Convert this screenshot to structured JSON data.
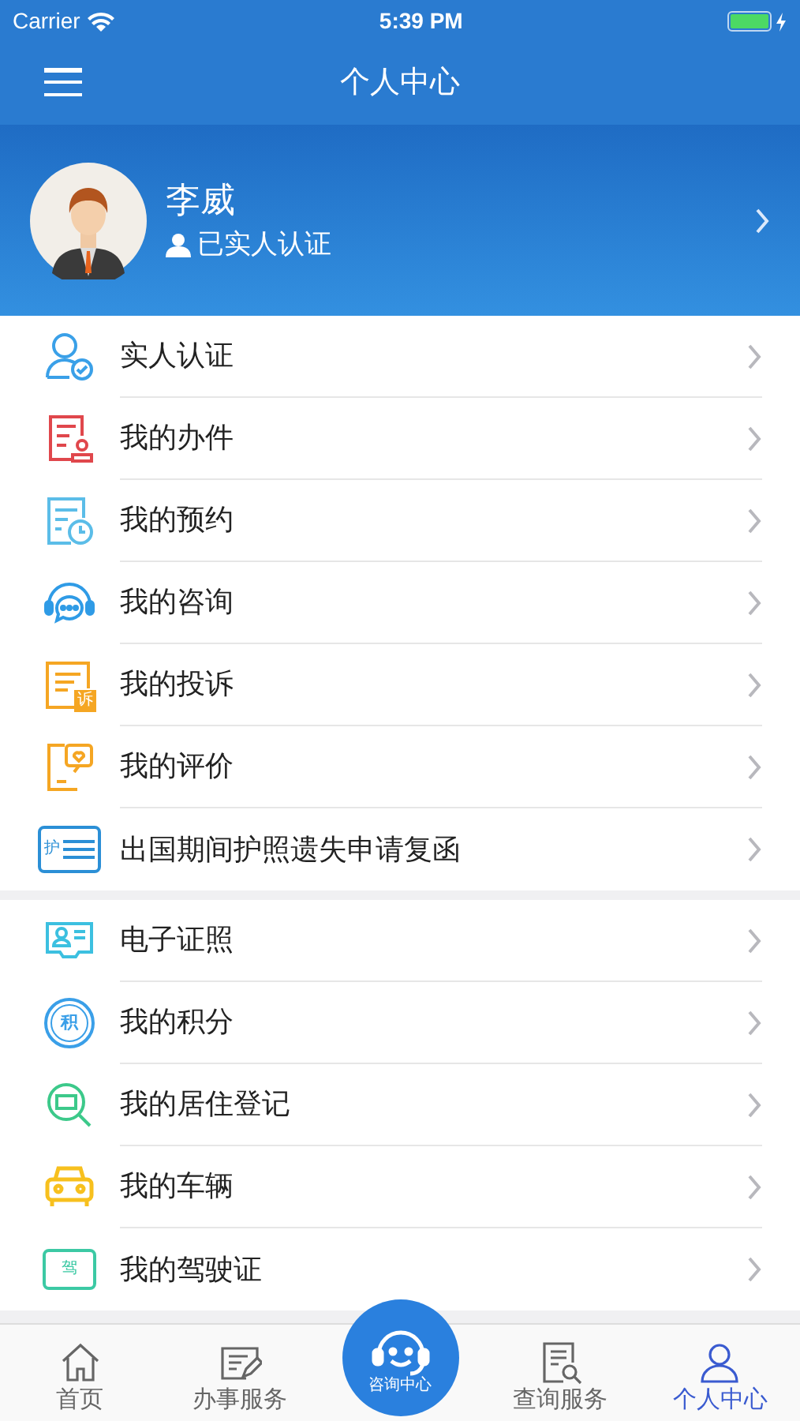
{
  "status_bar": {
    "carrier": "Carrier",
    "time": "5:39 PM"
  },
  "nav": {
    "title": "个人中心"
  },
  "profile": {
    "name": "李威",
    "badge": "已实人认证"
  },
  "groups": [
    [
      {
        "kind": "verify",
        "label": "实人认证"
      },
      {
        "kind": "cases",
        "label": "我的办件"
      },
      {
        "kind": "appointment",
        "label": "我的预约"
      },
      {
        "kind": "consult",
        "label": "我的咨询"
      },
      {
        "kind": "complaint",
        "label": "我的投诉",
        "icon_text": "诉"
      },
      {
        "kind": "review",
        "label": "我的评价"
      },
      {
        "kind": "passport",
        "label": "出国期间护照遗失申请复函",
        "icon_text": "护"
      }
    ],
    [
      {
        "kind": "license",
        "label": "电子证照"
      },
      {
        "kind": "points",
        "label": "我的积分",
        "icon_text": "积"
      },
      {
        "kind": "residence",
        "label": "我的居住登记"
      },
      {
        "kind": "vehicle",
        "label": "我的车辆"
      },
      {
        "kind": "driver",
        "label": "我的驾驶证",
        "icon_text": "驾"
      }
    ]
  ],
  "tabs": [
    {
      "kind": "home",
      "label": "首页",
      "selected": false
    },
    {
      "kind": "service",
      "label": "办事服务",
      "selected": false
    },
    {
      "kind": "center",
      "label": "咨询中心",
      "selected": false
    },
    {
      "kind": "query",
      "label": "查询服务",
      "selected": false
    },
    {
      "kind": "user",
      "label": "个人中心",
      "selected": true
    }
  ]
}
